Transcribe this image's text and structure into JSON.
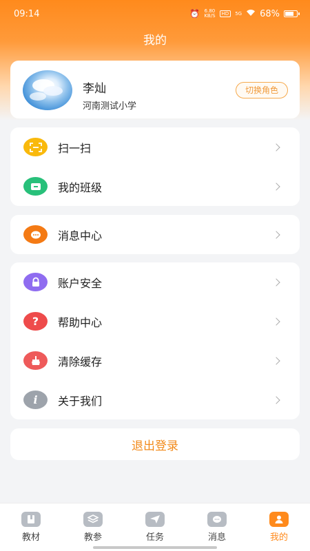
{
  "status_bar": {
    "time": "09:14",
    "net_speed_value": "6.80",
    "net_speed_unit": "KB/S",
    "nfc": "HD",
    "signal": "5G",
    "battery": "68%"
  },
  "header": {
    "title": "我的"
  },
  "profile": {
    "name": "李灿",
    "school": "河南测试小学",
    "switch_role_label": "切换角色"
  },
  "menu_group_1": [
    {
      "label": "扫一扫",
      "icon": "scan-icon",
      "color": "#f9b90c"
    },
    {
      "label": "我的班级",
      "icon": "class-icon",
      "color": "#28c07a"
    }
  ],
  "menu_group_2": [
    {
      "label": "消息中心",
      "icon": "message-icon",
      "color": "#f47a14"
    }
  ],
  "menu_group_3": [
    {
      "label": "账户安全",
      "icon": "lock-icon",
      "color": "#8f6cf0"
    },
    {
      "label": "帮助中心",
      "icon": "help-icon",
      "color": "#ee4b4b"
    },
    {
      "label": "清除缓存",
      "icon": "broom-icon",
      "color": "#ee5a5a"
    },
    {
      "label": "关于我们",
      "icon": "info-icon",
      "color": "#9da3ab"
    }
  ],
  "logout_label": "退出登录",
  "tabs": [
    {
      "label": "教材",
      "icon": "book-icon",
      "active": false
    },
    {
      "label": "教参",
      "icon": "layers-icon",
      "active": false
    },
    {
      "label": "任务",
      "icon": "send-icon",
      "active": false
    },
    {
      "label": "消息",
      "icon": "chat-icon",
      "active": false
    },
    {
      "label": "我的",
      "icon": "user-icon",
      "active": true
    }
  ],
  "colors": {
    "accent": "#ff8a1c",
    "background": "#f3f4f6",
    "tab_inactive": "#b7bcc3"
  }
}
